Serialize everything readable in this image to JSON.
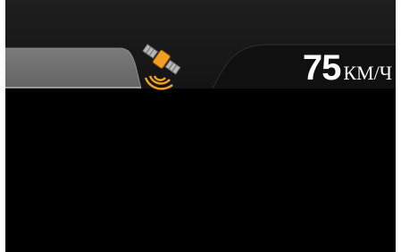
{
  "status_bar": {
    "gps_icon": "satellite-signal-icon",
    "speed": {
      "value": "75",
      "unit": "КМ/Ч"
    }
  },
  "colors": {
    "background": "#000000",
    "panel": "#1b1b1b",
    "tab": "#6e6e6e",
    "accent": "#f0a020",
    "text": "#ffffff"
  }
}
